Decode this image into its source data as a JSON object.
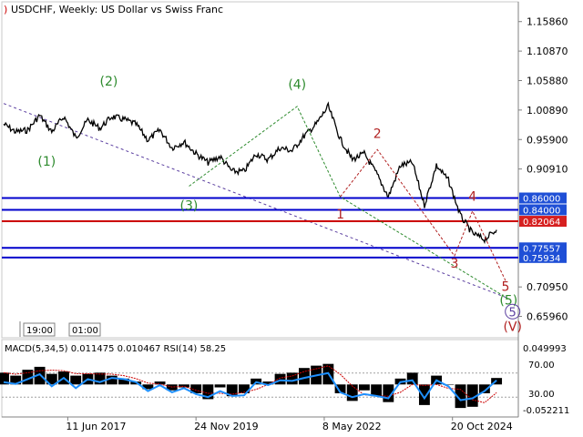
{
  "window": {
    "title": "USDCHF, Weekly:  US Dollar vs Swiss Franc",
    "time_boxes": [
      "19:00",
      "01:00"
    ]
  },
  "indicator": {
    "header": "MACD(5,34,5) 0.011475 0.010467 RSI(14) 58.25",
    "axis_labels": [
      "0.049993",
      "70.00",
      "30.00",
      "-0.052211"
    ]
  },
  "colors": {
    "price": "#000000",
    "level_blue": "#0000cc",
    "level_red": "#cc0000",
    "wave_green": "#2e8b2e",
    "wave_red": "#b22222",
    "trend_purple": "#5b3fa0",
    "macd_hist": "#000000",
    "macd_signal": "#cc0000",
    "rsi": "#1e90ff",
    "level_label_bg_blue": "#1f4fd6",
    "level_label_bg_red": "#d62020"
  },
  "chart_data": {
    "type": "line",
    "title": "USDCHF, Weekly:  US Dollar vs Swiss Franc",
    "x_tick_labels": [
      "11 Jun 2017",
      "24 Nov 2019",
      "8 May 2022",
      "20 Oct 2024"
    ],
    "x_ticks": [
      "2017-06-11",
      "2019-11-24",
      "2022-05-08",
      "2024-10-20"
    ],
    "y_tick_labels": [
      "1.15860",
      "1.10870",
      "1.05880",
      "1.00890",
      "0.95900",
      "0.90910",
      "0.70950",
      "0.65960"
    ],
    "ylim": [
      0.625,
      1.189
    ],
    "series": [
      {
        "x": [
          "2016-03-20",
          "2016-06-12",
          "2016-09-04",
          "2016-11-27",
          "2017-02-19",
          "2017-05-14",
          "2017-08-06",
          "2017-10-29",
          "2018-01-21",
          "2018-04-15",
          "2018-07-08",
          "2018-09-30",
          "2018-12-23",
          "2019-03-17",
          "2019-06-09",
          "2019-09-01",
          "2019-11-24",
          "2020-02-16",
          "2020-05-10",
          "2020-08-02",
          "2020-10-25",
          "2021-01-17",
          "2021-04-11",
          "2021-07-04",
          "2021-09-26",
          "2021-12-19",
          "2022-03-13",
          "2022-06-05",
          "2022-08-28",
          "2022-11-20",
          "2023-02-12",
          "2023-05-07",
          "2023-07-30",
          "2023-10-22",
          "2024-01-14",
          "2024-04-07",
          "2024-06-30",
          "2024-09-22",
          "2024-12-15",
          "2025-03-09",
          "2025-06-01",
          "2025-08-24"
        ],
        "y": [
          0.985,
          0.972,
          0.975,
          1.0,
          0.972,
          0.998,
          0.962,
          0.992,
          0.978,
          0.998,
          0.993,
          0.985,
          0.958,
          0.975,
          0.945,
          0.955,
          0.935,
          0.92,
          0.93,
          0.905,
          0.905,
          0.935,
          0.925,
          0.945,
          0.94,
          0.965,
          0.985,
          1.015,
          0.96,
          0.925,
          0.935,
          0.902,
          0.862,
          0.915,
          0.92,
          0.848,
          0.915,
          0.89,
          0.83,
          0.8,
          0.79,
          0.806
        ]
      }
    ],
    "price_levels": [
      {
        "value": 0.86,
        "label": "0.86000",
        "color": "#0000cc"
      },
      {
        "value": 0.84,
        "label": "0.84000",
        "color": "#0000cc"
      },
      {
        "value": 0.82064,
        "label": "0.82064",
        "color": "#cc0000"
      },
      {
        "value": 0.77557,
        "label": "0.77557",
        "color": "#0000cc"
      },
      {
        "value": 0.75934,
        "label": "0.75934",
        "color": "#0000cc"
      }
    ],
    "wave_labels_green": [
      {
        "text": "(1)",
        "x": "2017-01-15",
        "y": 0.915
      },
      {
        "text": "(2)",
        "x": "2018-03-25",
        "y": 1.05
      },
      {
        "text": "(3)",
        "x": "2019-10-06",
        "y": 0.84
      },
      {
        "text": "(4)",
        "x": "2021-10-31",
        "y": 1.045
      },
      {
        "text": "(5)",
        "x": "2025-11-16",
        "y": 0.68
      }
    ],
    "wave_labels_red": [
      {
        "text": "1",
        "x": "2022-08-28",
        "y": 0.825
      },
      {
        "text": "2",
        "x": "2023-05-14",
        "y": 0.962
      },
      {
        "text": "3",
        "x": "2024-11-03",
        "y": 0.742
      },
      {
        "text": "4",
        "x": "2025-03-09",
        "y": 0.855
      },
      {
        "text": "5",
        "x": "2025-10-26",
        "y": 0.703
      },
      {
        "text": "(V)",
        "x": "2025-12-14",
        "y": 0.635
      }
    ],
    "wave_label_purple": {
      "text": "5",
      "x": "2025-12-14",
      "y": 0.66
    },
    "green_wave_path": [
      {
        "x": "2019-10-06",
        "y": 0.88
      },
      {
        "x": "2021-10-31",
        "y": 1.015
      },
      {
        "x": "2022-08-28",
        "y": 0.862
      },
      {
        "x": "2025-11-09",
        "y": 0.69
      }
    ],
    "red_wave_path": [
      {
        "x": "2022-08-28",
        "y": 0.862
      },
      {
        "x": "2023-05-14",
        "y": 0.942
      },
      {
        "x": "2024-11-03",
        "y": 0.762
      },
      {
        "x": "2025-03-09",
        "y": 0.838
      },
      {
        "x": "2025-10-26",
        "y": 0.72
      }
    ],
    "trend_line": [
      {
        "x": "2016-03-20",
        "y": 1.02
      },
      {
        "x": "2025-11-16",
        "y": 0.69
      }
    ],
    "indicator": {
      "macd_params": "5,34,5",
      "macd_main": 0.011475,
      "macd_signal": 0.010467,
      "rsi_period": 14,
      "rsi": 58.25,
      "macd_ylim": [
        -0.052211,
        0.049993
      ],
      "rsi_levels": [
        70,
        30
      ],
      "macd_hist": [
        0.02,
        0.015,
        0.025,
        0.03,
        0.018,
        0.022,
        0.015,
        0.018,
        0.02,
        0.015,
        0.01,
        0.005,
        -0.008,
        0.005,
        -0.01,
        -0.005,
        -0.015,
        -0.025,
        -0.005,
        -0.02,
        -0.015,
        0.01,
        0.005,
        0.018,
        0.02,
        0.028,
        0.032,
        0.035,
        -0.015,
        -0.028,
        -0.01,
        -0.02,
        -0.03,
        0.01,
        0.02,
        -0.035,
        0.015,
        0.0,
        -0.04,
        -0.038,
        -0.015,
        0.011
      ],
      "rsi_values": [
        55,
        52,
        60,
        68,
        48,
        62,
        45,
        60,
        55,
        62,
        60,
        55,
        40,
        50,
        38,
        45,
        35,
        30,
        40,
        32,
        33,
        55,
        50,
        58,
        57,
        62,
        66,
        70,
        38,
        30,
        35,
        32,
        28,
        55,
        58,
        28,
        58,
        48,
        25,
        28,
        40,
        58
      ]
    }
  }
}
